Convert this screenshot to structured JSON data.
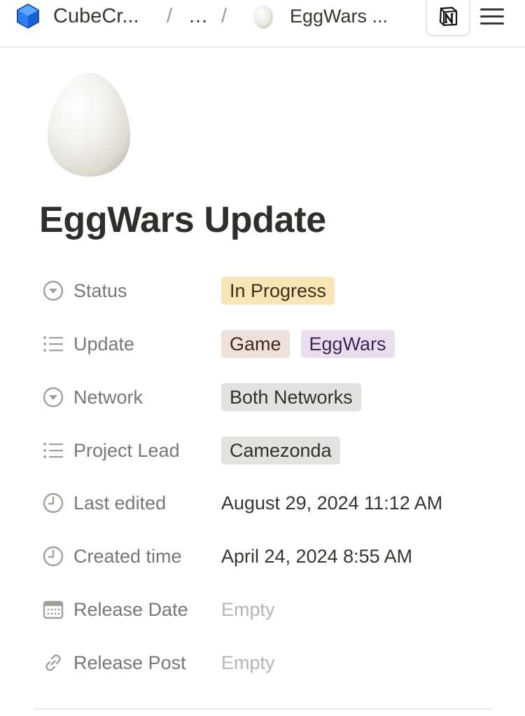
{
  "topbar": {
    "workspace_name": "CubeCr...",
    "separator": "/",
    "ellipsis": "...",
    "breadcrumb_label": "EggWars ..."
  },
  "page": {
    "title": "EggWars Update",
    "icon": "egg-icon"
  },
  "properties": {
    "status": {
      "label": "Status",
      "icon": "select-circle-icon",
      "tags": [
        "In Progress"
      ]
    },
    "update": {
      "label": "Update",
      "icon": "multi-select-list-icon",
      "tags": [
        "Game",
        "EggWars"
      ]
    },
    "network": {
      "label": "Network",
      "icon": "select-circle-icon",
      "tags": [
        "Both Networks"
      ]
    },
    "project_lead": {
      "label": "Project Lead",
      "icon": "multi-select-list-icon",
      "tags": [
        "Camezonda"
      ]
    },
    "last_edited": {
      "label": "Last edited",
      "icon": "clock-icon",
      "value": "August 29, 2024 11:12 AM"
    },
    "created_time": {
      "label": "Created time",
      "icon": "clock-icon",
      "value": "April 24, 2024 8:55 AM"
    },
    "release_date": {
      "label": "Release Date",
      "icon": "calendar-icon",
      "value": "Empty"
    },
    "release_post": {
      "label": "Release Post",
      "icon": "link-icon",
      "value": "Empty"
    }
  },
  "colors": {
    "tag_yellow": "#f9e4b6",
    "tag_brown": "#eee0da",
    "tag_purple": "#e8deee",
    "tag_gray": "#e3e2e0",
    "workspace_blue": "#2d7ff9"
  }
}
